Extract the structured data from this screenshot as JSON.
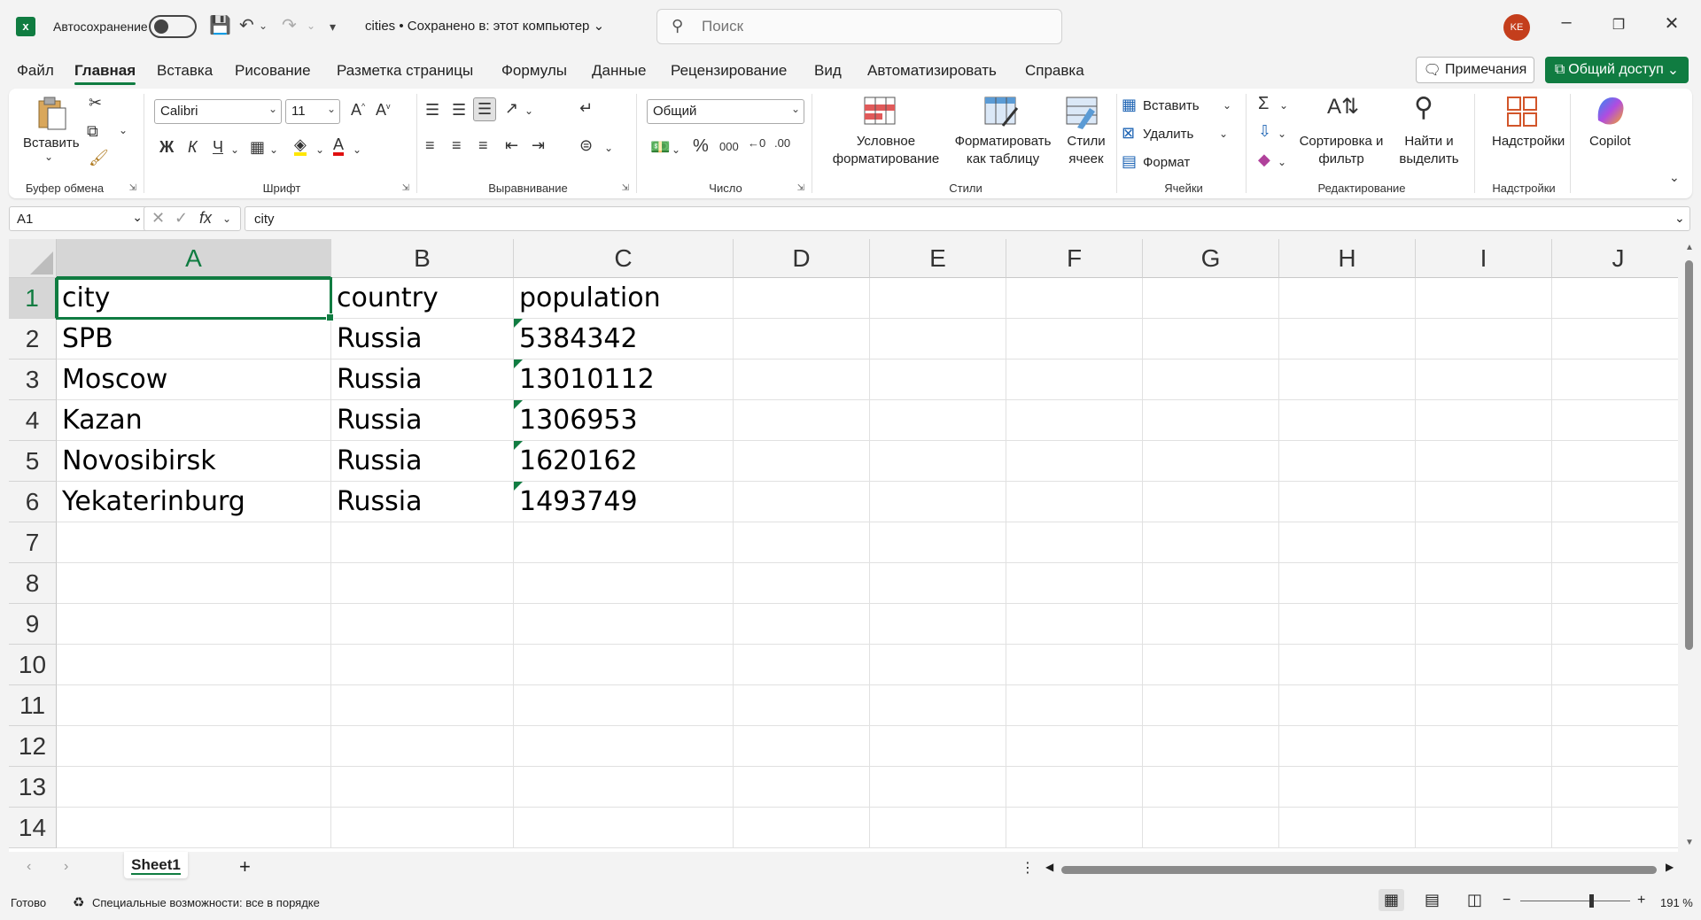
{
  "titlebar": {
    "autosave_label": "Автосохранение",
    "doc_title": "cities • Сохранено в: этот компьютер",
    "search_placeholder": "Поиск",
    "avatar_initials": "KE"
  },
  "menu": {
    "items": [
      "Файл",
      "Главная",
      "Вставка",
      "Рисование",
      "Разметка страницы",
      "Формулы",
      "Данные",
      "Рецензирование",
      "Вид",
      "Автоматизировать",
      "Справка"
    ],
    "active": "Главная",
    "notes_label": "Примечания",
    "share_label": "Общий доступ"
  },
  "ribbon": {
    "clipboard": {
      "paste_label": "Вставить",
      "group_label": "Буфер обмена"
    },
    "font": {
      "name": "Calibri",
      "size": "11",
      "bold": "Ж",
      "italic": "К",
      "underline": "Ч",
      "group_label": "Шрифт"
    },
    "alignment": {
      "group_label": "Выравнивание"
    },
    "number": {
      "format": "Общий",
      "group_label": "Число"
    },
    "styles": {
      "conditional": "Условное форматирование",
      "format_table": "Форматировать как таблицу",
      "cell_styles": "Стили ячеек",
      "group_label": "Стили"
    },
    "cells": {
      "insert": "Вставить",
      "delete": "Удалить",
      "format": "Формат",
      "group_label": "Ячейки"
    },
    "editing": {
      "sort_filter": "Сортировка и фильтр",
      "find_select": "Найти и выделить",
      "group_label": "Редактирование"
    },
    "addins": {
      "label": "Надстройки",
      "group_label": "Надстройки"
    },
    "copilot": {
      "label": "Copilot"
    }
  },
  "formula_bar": {
    "name_box": "A1",
    "formula": "city"
  },
  "sheet": {
    "columns": [
      "A",
      "B",
      "C",
      "D",
      "E",
      "F",
      "G",
      "H",
      "I",
      "J"
    ],
    "rows": [
      "1",
      "2",
      "3",
      "4",
      "5",
      "6",
      "7",
      "8",
      "9",
      "10",
      "11",
      "12",
      "13",
      "14"
    ],
    "cells": [
      [
        "city",
        "country",
        "population"
      ],
      [
        "SPB",
        "Russia",
        "5384342"
      ],
      [
        "Moscow",
        "Russia",
        "13010112"
      ],
      [
        "Kazan",
        "Russia",
        "1306953"
      ],
      [
        "Novosibirsk",
        "Russia",
        "1620162"
      ],
      [
        "Yekaterinburg",
        "Russia",
        "1493749"
      ]
    ],
    "selected_cell": "A1"
  },
  "tabs": {
    "sheets": [
      "Sheet1"
    ],
    "add_label": "+"
  },
  "status": {
    "ready": "Готово",
    "accessibility": "Специальные возможности: все в порядке",
    "zoom": "191 %",
    "zoom_minus": "−",
    "zoom_plus": "+"
  },
  "colors": {
    "accent": "#107c41",
    "avatar": "#c43e1c"
  }
}
